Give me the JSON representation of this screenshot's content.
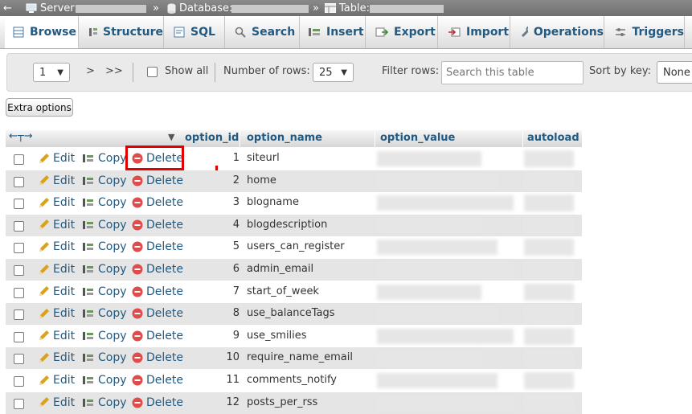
{
  "breadcrumb": {
    "back_arrow": "←",
    "server_label": "Server:",
    "database_label": "Database:",
    "table_label": "Table:",
    "sep": "»"
  },
  "tabs": [
    {
      "label": "Browse",
      "icon": "browse-icon"
    },
    {
      "label": "Structure",
      "icon": "structure-icon"
    },
    {
      "label": "SQL",
      "icon": "sql-icon"
    },
    {
      "label": "Search",
      "icon": "search-icon"
    },
    {
      "label": "Insert",
      "icon": "insert-icon"
    },
    {
      "label": "Export",
      "icon": "export-icon"
    },
    {
      "label": "Import",
      "icon": "import-icon"
    },
    {
      "label": "Operations",
      "icon": "wrench-icon"
    },
    {
      "label": "Triggers",
      "icon": "triggers-icon"
    }
  ],
  "nav": {
    "page_value": "1",
    "next": ">",
    "last": ">>",
    "show_all": "Show all",
    "rows_label": "Number of rows:",
    "rows_value": "25",
    "filter_label": "Filter rows:",
    "filter_placeholder": "Search this table",
    "sort_label": "Sort by key:",
    "sort_value": "None"
  },
  "extra_options": "Extra options",
  "columns": {
    "option_id": "option_id",
    "option_name": "option_name",
    "option_value": "option_value",
    "autoload": "autoload"
  },
  "actions": {
    "edit": "Edit",
    "copy": "Copy",
    "delete": "Delete"
  },
  "rows": [
    {
      "id": "1",
      "name": "siteurl"
    },
    {
      "id": "2",
      "name": "home"
    },
    {
      "id": "3",
      "name": "blogname"
    },
    {
      "id": "4",
      "name": "blogdescription"
    },
    {
      "id": "5",
      "name": "users_can_register"
    },
    {
      "id": "6",
      "name": "admin_email"
    },
    {
      "id": "7",
      "name": "start_of_week"
    },
    {
      "id": "8",
      "name": "use_balanceTags"
    },
    {
      "id": "9",
      "name": "use_smilies"
    },
    {
      "id": "10",
      "name": "require_name_email"
    },
    {
      "id": "11",
      "name": "comments_notify"
    },
    {
      "id": "12",
      "name": "posts_per_rss"
    }
  ],
  "colors": {
    "link": "#235a81",
    "highlight": "#e00000",
    "row_alt": "#e5e5e5",
    "delete_icon": "#e04b4b",
    "edit_icon": "#d9a21b"
  }
}
